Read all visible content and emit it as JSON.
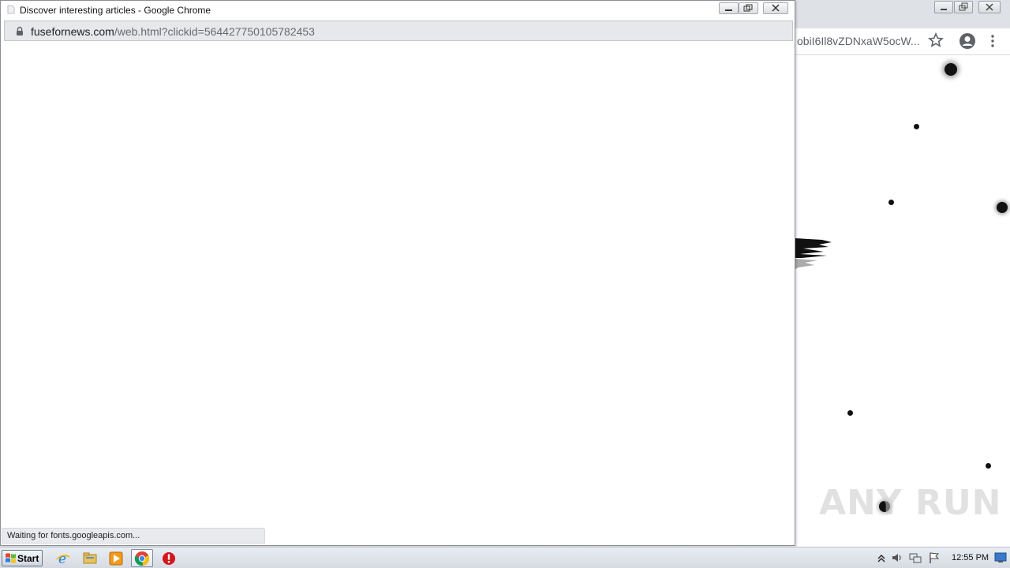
{
  "background_window": {
    "url_fragment": "obiI6Il8vZDNxaW5ocW..."
  },
  "popup": {
    "title": "Discover interesting articles - Google Chrome",
    "url_host": "fusefornews.com",
    "url_path": "/web.html?clickid=564427750105782453",
    "status_text": "Waiting for fonts.googleapis.com..."
  },
  "watermark": "ANY RUN",
  "taskbar": {
    "start_label": "Start",
    "clock": "12:55 PM"
  }
}
